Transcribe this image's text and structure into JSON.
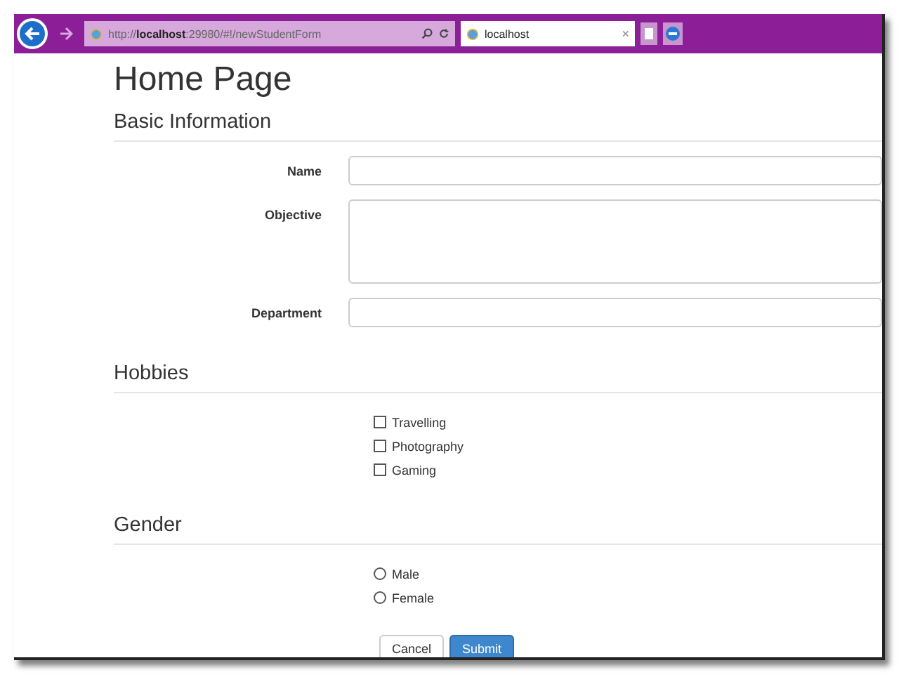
{
  "browser": {
    "url": "http://**localhost**:29980/#!/newStudentForm",
    "tab": {
      "title": "localhost",
      "close": "×",
      "selected": true
    }
  },
  "page": {
    "title": "Home Page"
  },
  "basic_information": {
    "heading": "Basic Information",
    "fields": [
      {
        "label": "Name",
        "kind": "text"
      },
      {
        "label": "Objective",
        "kind": "textarea"
      },
      {
        "label": "Department",
        "kind": "text"
      }
    ]
  },
  "hobbies": {
    "heading": "Hobbies",
    "options": [
      {
        "label": "Travelling",
        "checked": false
      },
      {
        "label": "Photography",
        "checked": false
      },
      {
        "label": "Gaming",
        "checked": false
      }
    ]
  },
  "gender": {
    "heading": "Gender",
    "options": [
      {
        "label": "Male",
        "selected": false
      },
      {
        "label": "Female",
        "selected": false
      }
    ]
  },
  "buttons": [
    {
      "label": "Cancel",
      "kind": "default"
    },
    {
      "label": "Submit",
      "kind": "primary"
    }
  ]
}
